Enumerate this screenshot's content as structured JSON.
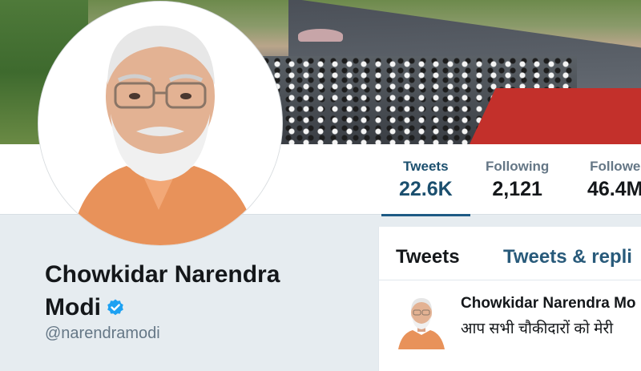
{
  "profile": {
    "name_line1": "Chowkidar Narendra",
    "name_line2": "Modi",
    "handle": "@narendramodi",
    "verified_icon": "verified-badge-icon"
  },
  "stats": [
    {
      "label": "Tweets",
      "value": "22.6K",
      "active": true
    },
    {
      "label": "Following",
      "value": "2,121",
      "active": false
    },
    {
      "label": "Followe",
      "value": "46.4M",
      "active": false
    }
  ],
  "tabs": {
    "active_label": "Tweets",
    "second_label": "Tweets & repli"
  },
  "tweet": {
    "author": "Chowkidar Narendra Mo",
    "text": "आप सभी चौकीदारों को मेरी"
  },
  "colors": {
    "accent": "#1d5a85",
    "verified": "#1da1f2",
    "muted_text": "#657786",
    "page_background": "#e6ecf0"
  }
}
